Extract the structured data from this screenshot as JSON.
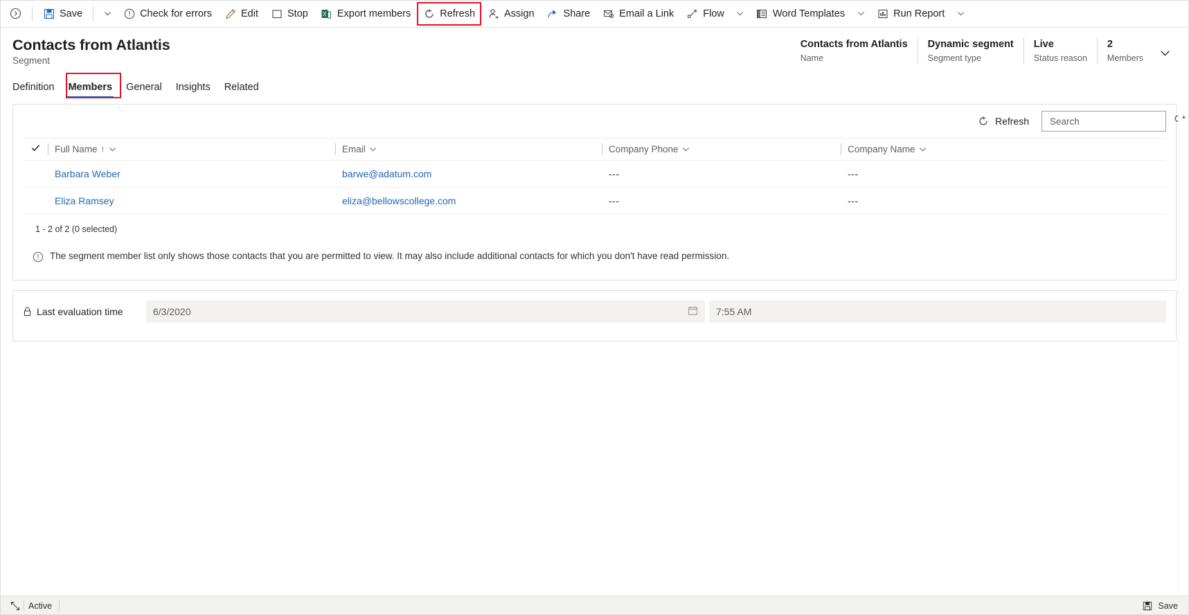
{
  "commandbar": {
    "back_icon": "back-chevron-circle-icon",
    "items": [
      {
        "label": "Save",
        "icon": "save-floppy-icon",
        "caret": true
      },
      {
        "label": "Check for errors",
        "icon": "exclamation-circle-icon",
        "caret": false
      },
      {
        "label": "Edit",
        "icon": "pencil-icon",
        "caret": false
      },
      {
        "label": "Stop",
        "icon": "stop-square-icon",
        "caret": false
      },
      {
        "label": "Export members",
        "icon": "excel-icon",
        "caret": false
      },
      {
        "label": "Refresh",
        "icon": "refresh-circular-arrow-icon",
        "caret": false,
        "highlighted": true
      },
      {
        "label": "Assign",
        "icon": "person-assign-icon",
        "caret": false
      },
      {
        "label": "Share",
        "icon": "share-arrow-icon",
        "caret": false
      },
      {
        "label": "Email a Link",
        "icon": "email-link-icon",
        "caret": false
      },
      {
        "label": "Flow",
        "icon": "flow-node-icon",
        "caret": true
      },
      {
        "label": "Word Templates",
        "icon": "word-document-icon",
        "caret": true
      },
      {
        "label": "Run Report",
        "icon": "report-chart-icon",
        "caret": true
      }
    ]
  },
  "header": {
    "title": "Contacts from Atlantis",
    "subtitle": "Segment",
    "fields": [
      {
        "value": "Contacts from Atlantis",
        "label": "Name"
      },
      {
        "value": "Dynamic segment",
        "label": "Segment type"
      },
      {
        "value": "Live",
        "label": "Status reason"
      },
      {
        "value": "2",
        "label": "Members"
      }
    ],
    "expand_icon": "chevron-down-icon"
  },
  "tabs": [
    {
      "label": "Definition",
      "selected": false
    },
    {
      "label": "Members",
      "selected": true,
      "highlighted": true
    },
    {
      "label": "General",
      "selected": false
    },
    {
      "label": "Insights",
      "selected": false
    },
    {
      "label": "Related",
      "selected": false
    }
  ],
  "grid_toolbar": {
    "refresh_label": "Refresh",
    "refresh_icon": "refresh-circular-arrow-icon",
    "search_placeholder": "Search",
    "search_value": "",
    "search_icon": "magnifier-icon"
  },
  "grid": {
    "select_all_icon": "checkmark-icon",
    "columns": [
      {
        "label": "Full Name",
        "sorted": true,
        "sort_icon": "sort-ascending-arrow-icon"
      },
      {
        "label": "Email",
        "sorted": false
      },
      {
        "label": "Company Phone",
        "sorted": false
      },
      {
        "label": "Company Name",
        "sorted": false
      }
    ],
    "column_menu_icon": "chevron-down-icon",
    "rows": [
      {
        "full_name": "Barbara Weber",
        "email": "barwe@adatum.com",
        "company_phone": "---",
        "company_name": "---"
      },
      {
        "full_name": "Eliza Ramsey",
        "email": "eliza@bellowscollege.com",
        "company_phone": "---",
        "company_name": "---"
      }
    ],
    "pager_text": "1 - 2 of 2 (0 selected)",
    "notice_icon": "info-circle-icon",
    "notice_text": "The segment member list only shows those contacts that you are permitted to view. It may also include additional contacts for which you don't have read permission."
  },
  "evaluation": {
    "lock_icon": "lock-closed-icon",
    "label": "Last evaluation time",
    "date_value": "6/3/2020",
    "calendar_icon": "calendar-icon",
    "time_value": "7:55 AM"
  },
  "footer": {
    "expand_icon": "expand-arrows-icon",
    "status": "Active",
    "save_label": "Save",
    "save_icon": "save-floppy-icon"
  },
  "colors": {
    "accent": "#0078d4",
    "link": "#2266bb",
    "highlight": "#e81123",
    "excel_green": "#217346"
  }
}
